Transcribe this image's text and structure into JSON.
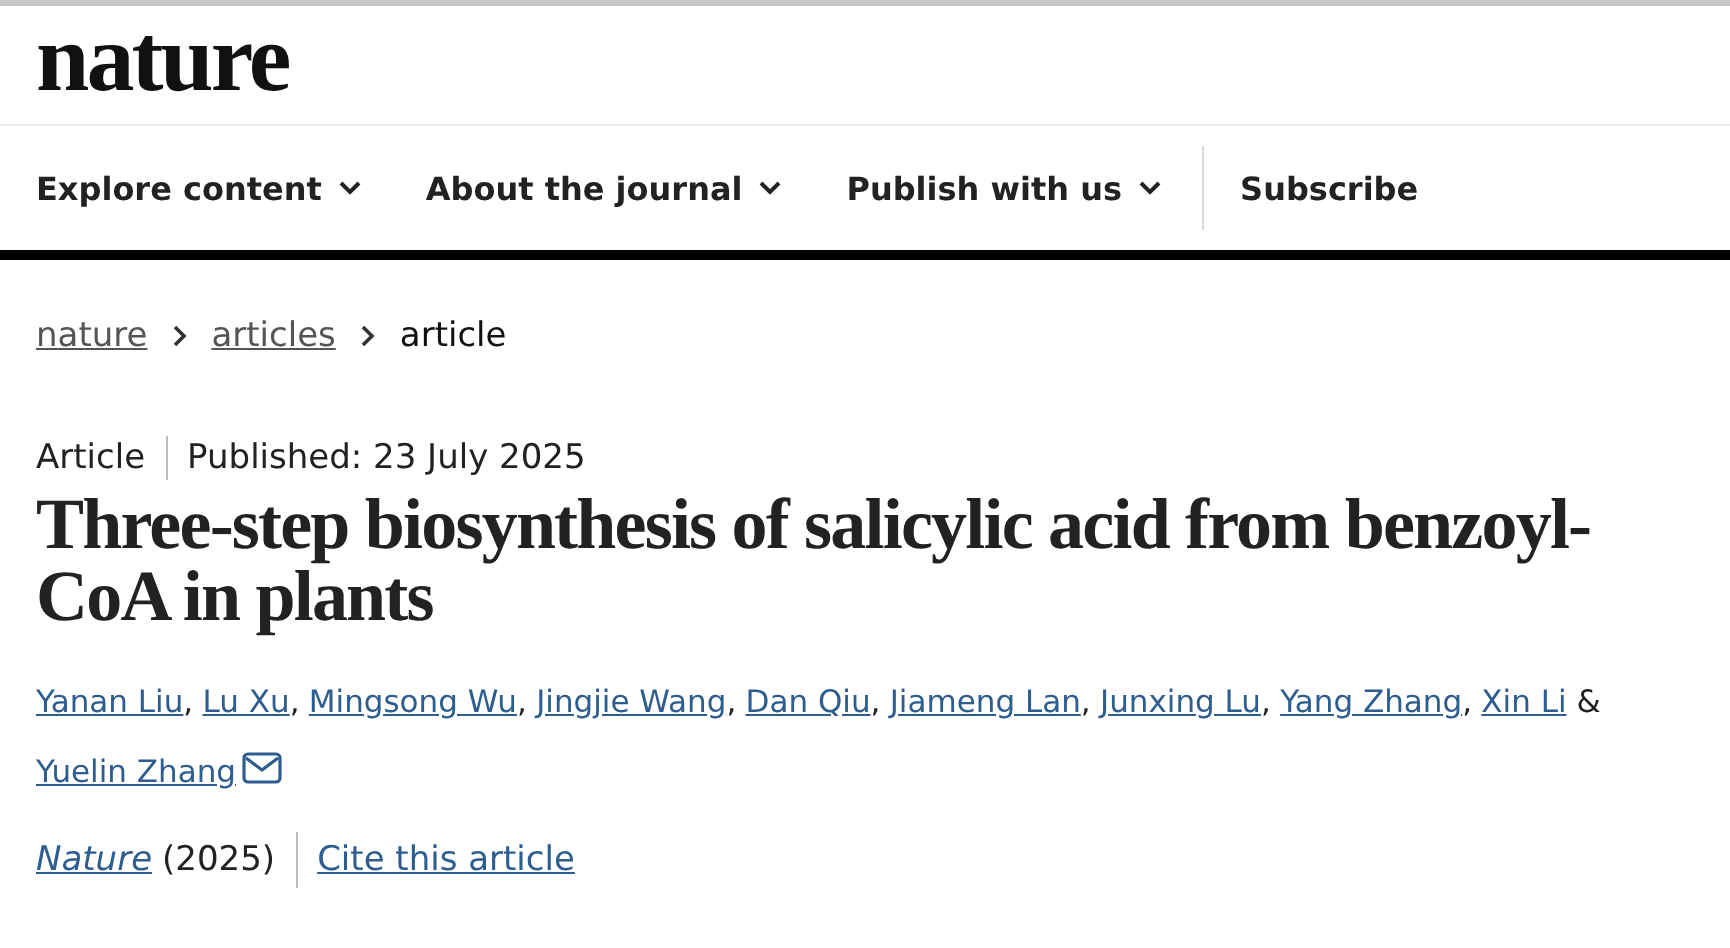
{
  "header": {
    "logo": "nature"
  },
  "nav": [
    {
      "label": "Explore content",
      "dropdown": true
    },
    {
      "label": "About the journal",
      "dropdown": true
    },
    {
      "label": "Publish with us",
      "dropdown": true
    },
    {
      "label": "Subscribe",
      "dropdown": false
    }
  ],
  "breadcrumb": [
    {
      "label": "nature",
      "link": true
    },
    {
      "label": "articles",
      "link": true
    },
    {
      "label": "article",
      "link": false
    }
  ],
  "article": {
    "type": "Article",
    "published": "Published: 23 July 2025",
    "title": "Three-step biosynthesis of salicylic acid from benzoyl-CoA in plants",
    "authors": [
      {
        "name": "Yanan Liu",
        "sep": ","
      },
      {
        "name": "Lu Xu",
        "sep": ","
      },
      {
        "name": "Mingsong Wu",
        "sep": ","
      },
      {
        "name": "Jingjie Wang",
        "sep": ","
      },
      {
        "name": "Dan Qiu",
        "sep": ","
      },
      {
        "name": "Jiameng Lan",
        "sep": ","
      },
      {
        "name": "Junxing Lu",
        "sep": ","
      },
      {
        "name": "Yang Zhang",
        "sep": ","
      },
      {
        "name": "Xin Li",
        "sep": " &"
      },
      {
        "name": "Yuelin Zhang",
        "email": true
      }
    ],
    "journal": "Nature",
    "year": "(2025)",
    "cite": "Cite this article"
  }
}
